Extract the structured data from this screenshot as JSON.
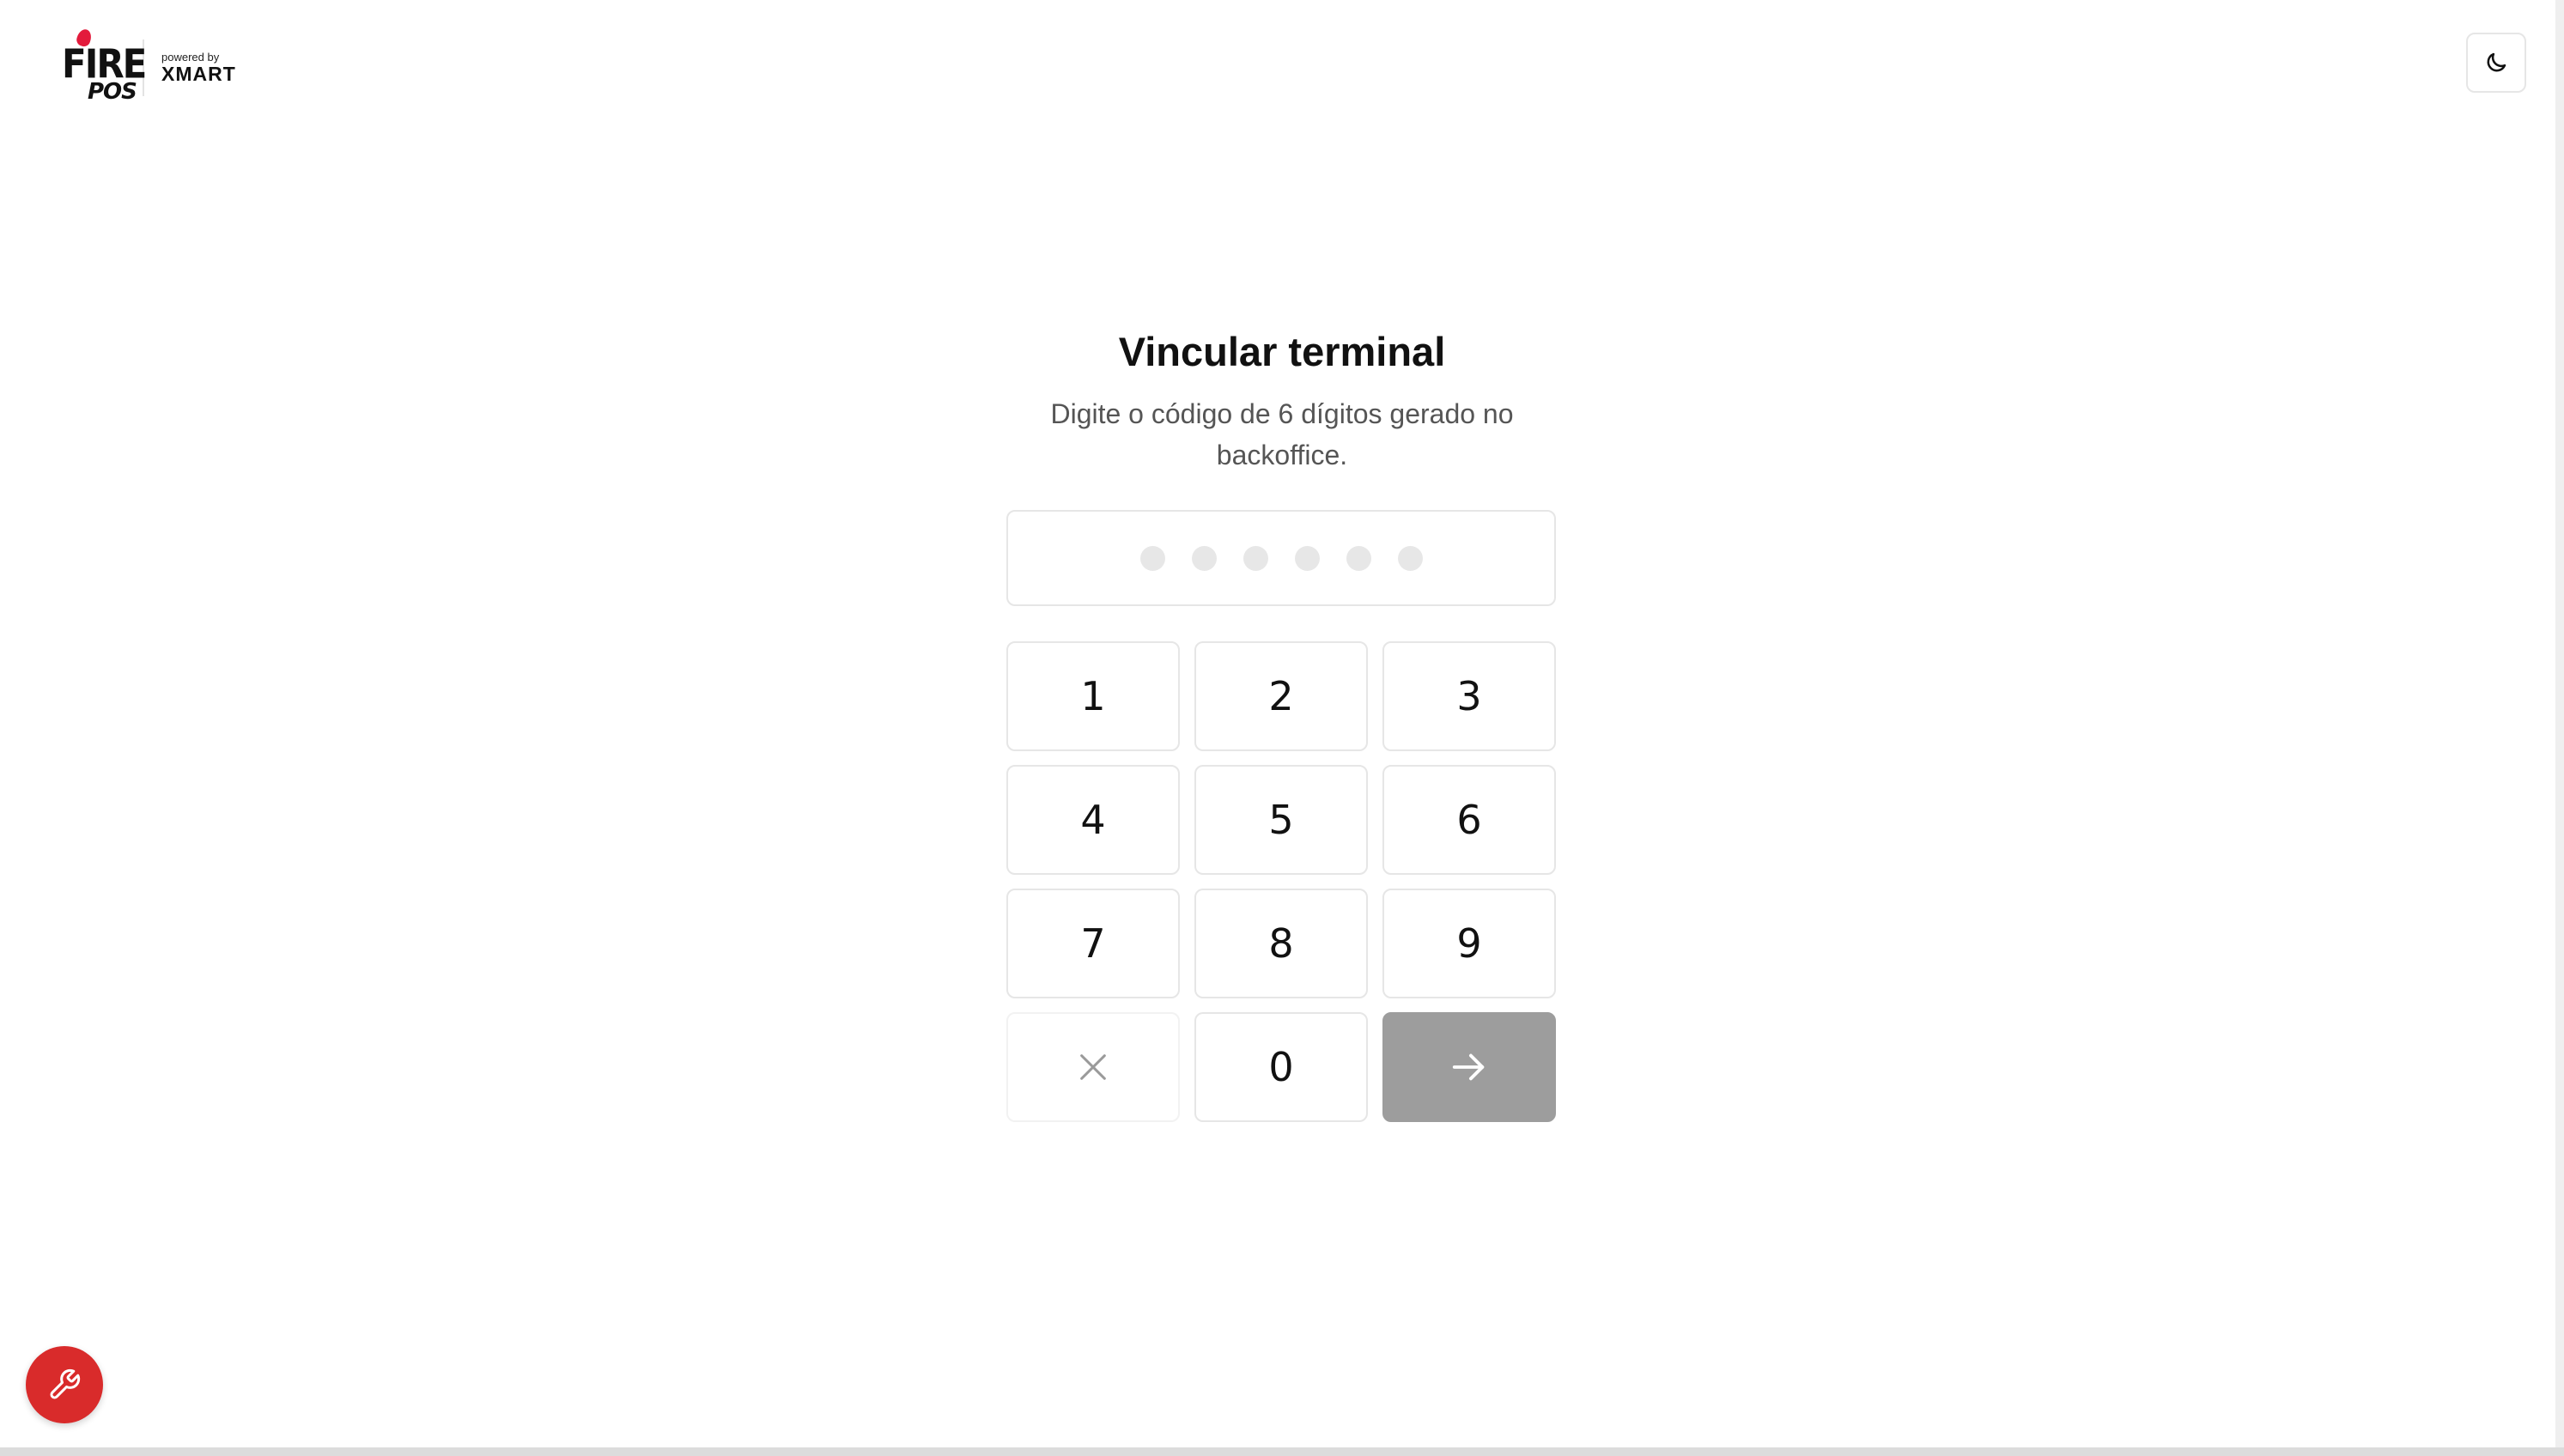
{
  "brand": {
    "fire_label": "FIRE",
    "pos_label": "POS",
    "powered_by_label": "powered by",
    "partner_label": "XMART",
    "accent_color": "#e31b3c"
  },
  "header": {
    "theme_toggle_icon": "moon-icon"
  },
  "main": {
    "title": "Vincular terminal",
    "subtitle": "Digite o código de 6 dígitos gerado no backoffice.",
    "code_length": 6,
    "code_value": ""
  },
  "keypad": {
    "digits": [
      "1",
      "2",
      "3",
      "4",
      "5",
      "6",
      "7",
      "8",
      "9",
      "0"
    ],
    "clear_icon": "close-icon",
    "submit_icon": "arrow-right-icon",
    "submit_color": "#9d9d9d"
  },
  "tools": {
    "icon": "wrench-icon",
    "color": "#d92b2b"
  }
}
